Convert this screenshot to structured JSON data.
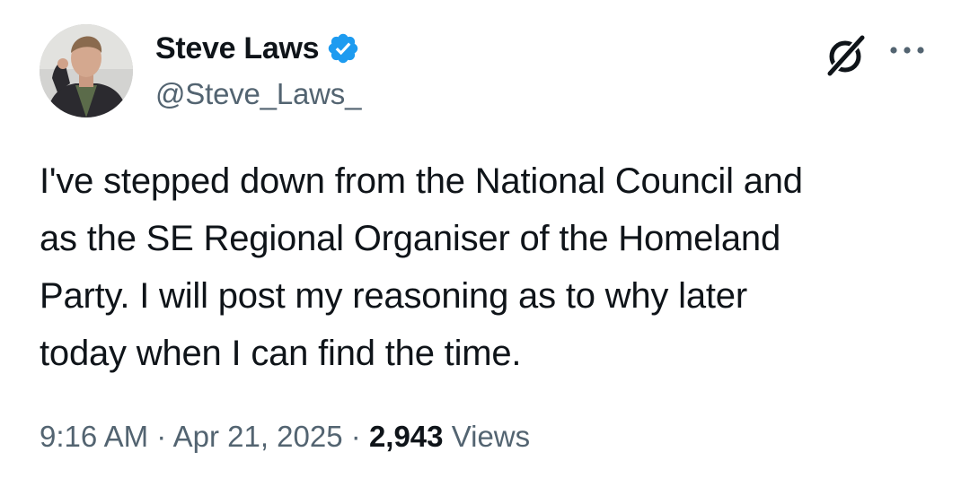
{
  "author": {
    "display_name": "Steve Laws",
    "handle": "@Steve_Laws_",
    "verified": true
  },
  "tweet": {
    "lines": [
      "I've stepped down from the National Council and",
      "as the SE Regional Organiser of the Homeland",
      "Party. I will post my reasoning as to why later",
      "today when I can find the time."
    ]
  },
  "meta": {
    "time": "9:16 AM",
    "separator": "·",
    "date": "Apr 21, 2025",
    "views_count": "2,943",
    "views_label": "Views"
  },
  "icons": {
    "verified": "verified-badge-icon",
    "grok": "grok-icon",
    "more": "more-dots-icon"
  },
  "colors": {
    "text_primary": "#0f1419",
    "text_secondary": "#536471",
    "verified_blue": "#1d9bf0",
    "background": "#ffffff"
  }
}
